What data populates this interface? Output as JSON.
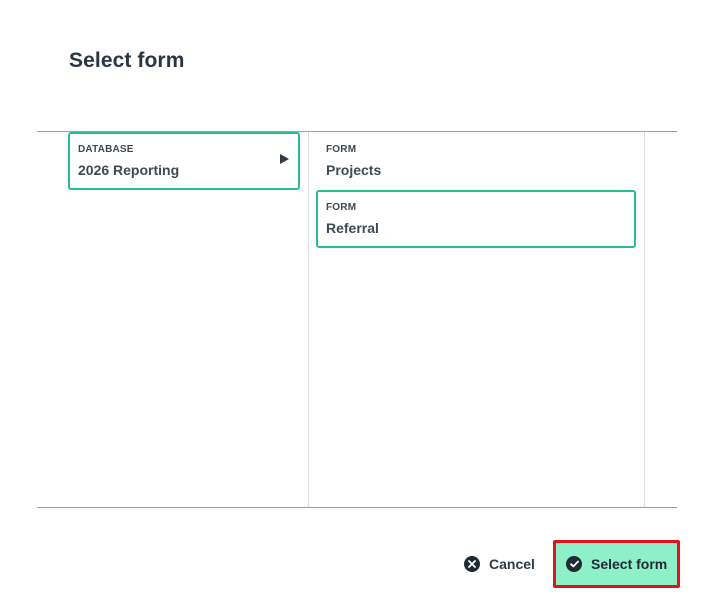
{
  "dialog": {
    "title": "Select form"
  },
  "database_column": {
    "items": [
      {
        "type": "DATABASE",
        "name": "2026 Reporting",
        "selected": true
      }
    ]
  },
  "form_column": {
    "items": [
      {
        "type": "FORM",
        "name": "Projects",
        "selected": false
      },
      {
        "type": "FORM",
        "name": "Referral",
        "selected": true
      }
    ]
  },
  "footer": {
    "cancel_label": "Cancel",
    "select_label": "Select form"
  },
  "colors": {
    "selection_border": "#27c08a",
    "primary_button_bg": "#8ef0c8",
    "highlight_outline": "#e0121a"
  },
  "icons": {
    "cancel": "close-circle-icon",
    "select": "check-circle-icon",
    "expand": "chevron-right-icon"
  }
}
